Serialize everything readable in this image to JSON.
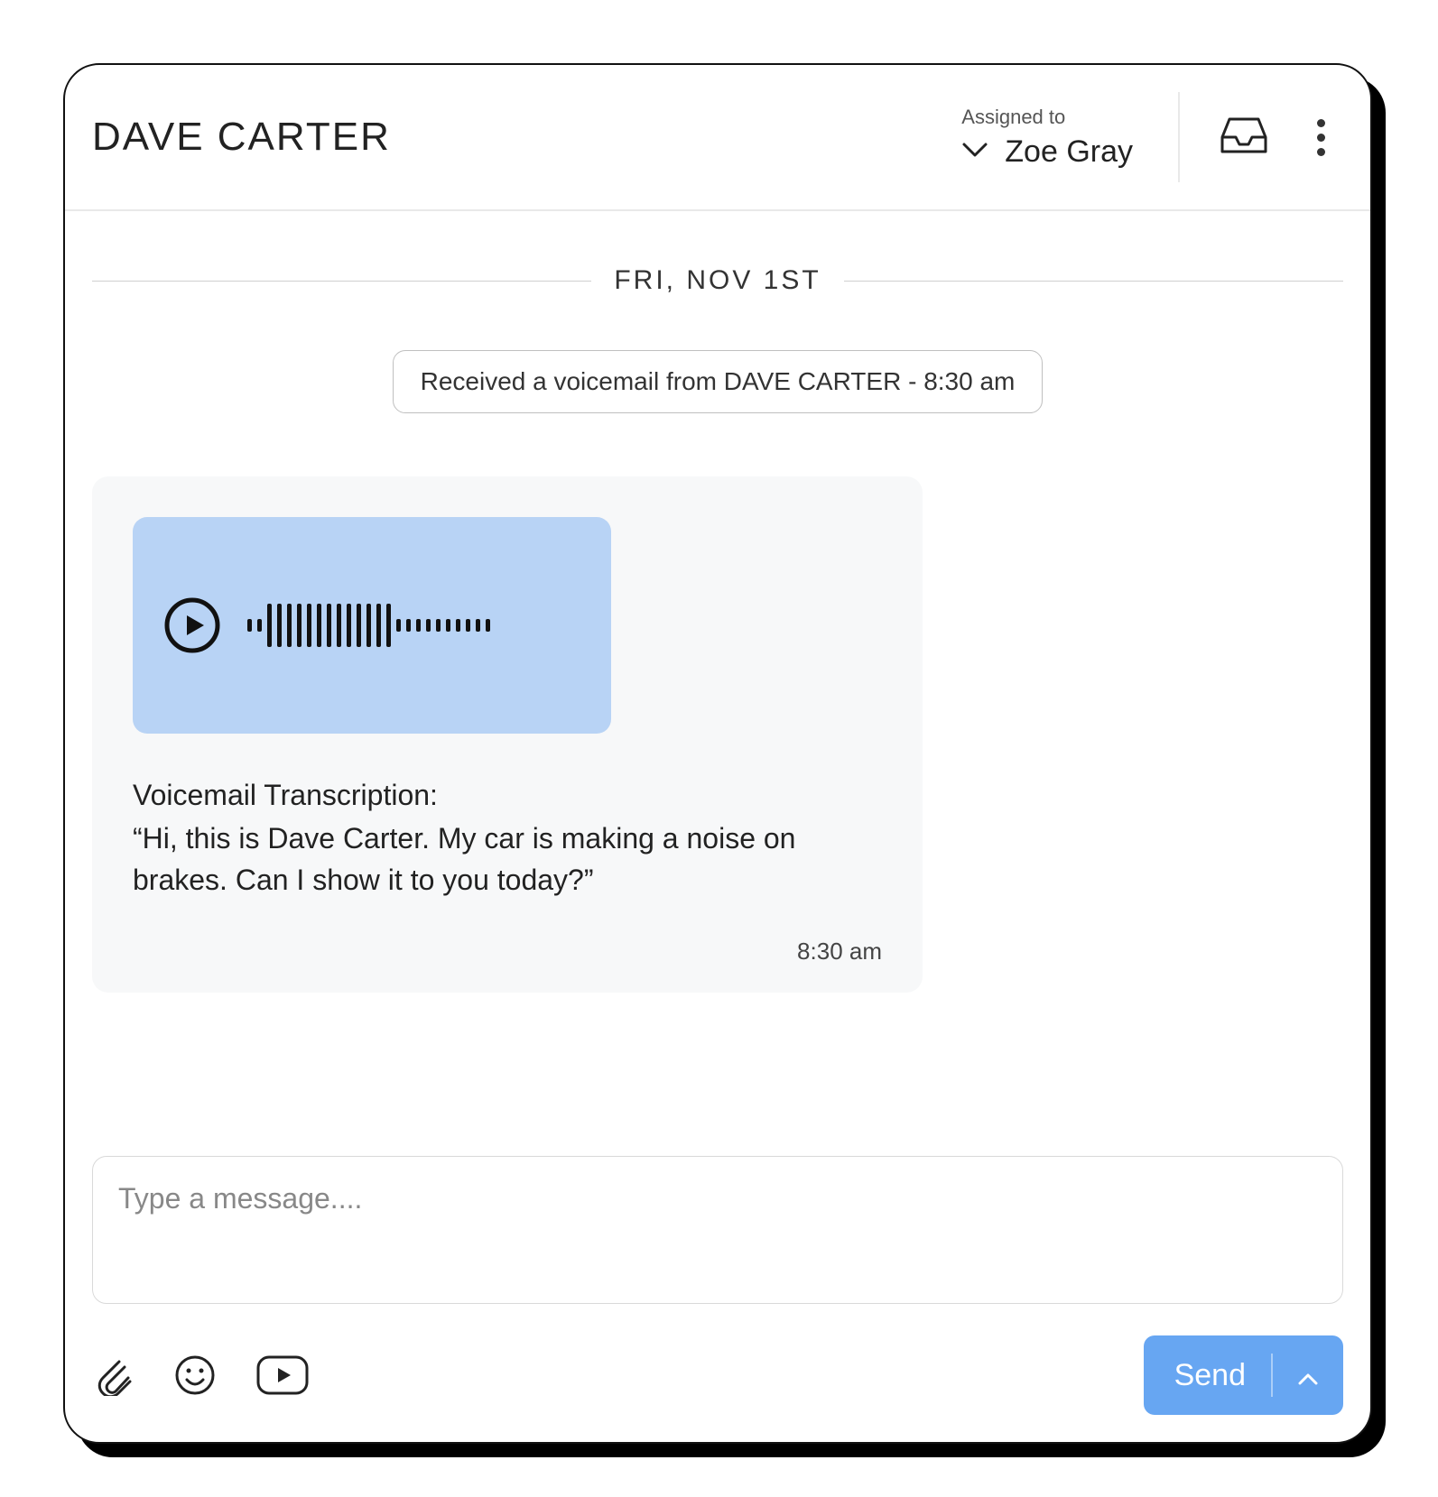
{
  "header": {
    "contact_name": "DAVE CARTER",
    "assigned_label": "Assigned to",
    "assigned_name": "Zoe Gray"
  },
  "conversation": {
    "date": "FRI, NOV 1ST",
    "event_chip": "Received a voicemail from DAVE CARTER - 8:30 am",
    "voicemail": {
      "transcription_label": "Voicemail Transcription:",
      "transcription_body": "“Hi, this is Dave Carter. My car is making a noise on brakes. Can I show it to you today?”",
      "time": "8:30 am"
    }
  },
  "composer": {
    "placeholder": "Type a message....",
    "send_label": "Send"
  },
  "colors": {
    "audio_bg": "#b8d3f5",
    "bubble_bg": "#f7f8f9",
    "send_bg": "#67a6f2"
  }
}
